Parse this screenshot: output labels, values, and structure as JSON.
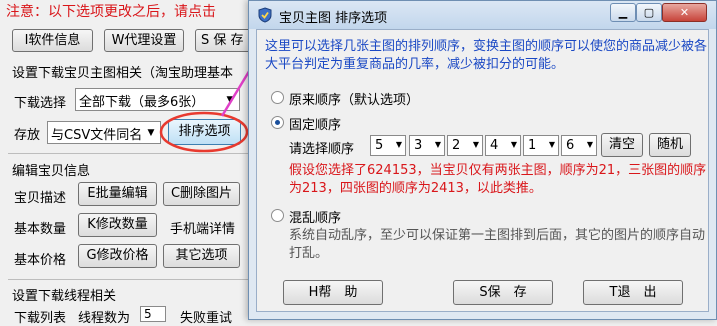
{
  "main": {
    "notice": "注意：以下选项更改之后，请点击",
    "toolbar": {
      "btn1": "I软件信息",
      "btn2": "W代理设置",
      "btn3": "S 保 存"
    },
    "download_section": "设置下载宝贝主图相关（淘宝助理基本",
    "download_label": "下载选择",
    "download_value": "全部下载（最多6张）",
    "store_label": "存放",
    "store_value": "与CSV文件同名",
    "sort_button": "排序选项",
    "edit_section": "编辑宝贝信息",
    "rows": [
      {
        "label": "宝贝描述",
        "btn_a": "E批量编辑",
        "btn_b": "C删除图片"
      },
      {
        "label": "基本数量",
        "btn_a": "K修改数量",
        "extra": "手机端详情"
      },
      {
        "label": "基本价格",
        "btn_a": "G修改价格",
        "btn_b": "其它选项"
      }
    ],
    "thread_section": "设置下载线程相关",
    "thread_row": {
      "label1": "下载列表",
      "label2": "线程数为",
      "value": "5",
      "label3": "失败重试"
    }
  },
  "dialog": {
    "title": "宝贝主图 排序选项",
    "description": "这里可以选择几张主图的排列顺序，变换主图的顺序可以使您的商品减少被各大平台判定为重复商品的几率，减少被扣分的可能。",
    "opt_original": "原来顺序（默认选项）",
    "opt_fixed": "固定顺序",
    "please_select": "请选择顺序",
    "order": [
      "5",
      "3",
      "2",
      "4",
      "1",
      "6"
    ],
    "clear_button": "清空",
    "random_button": "随机",
    "example": "假设您选择了624153，当宝贝仅有两张主图，顺序为21，三张图的顺序为213，四张图的顺序为2413，以此类推。",
    "opt_chaos": "混乱顺序",
    "chaos_desc": "系统自动乱序，至少可以保证第一主图排到后面，其它的图片的顺序自动打乱。",
    "help_button": "H帮　助",
    "save_button": "S保　存",
    "exit_button": "T退　出",
    "colors": {
      "accent": "#1a48c4",
      "warning": "#d9161a",
      "annotation": "#e040c8"
    }
  }
}
